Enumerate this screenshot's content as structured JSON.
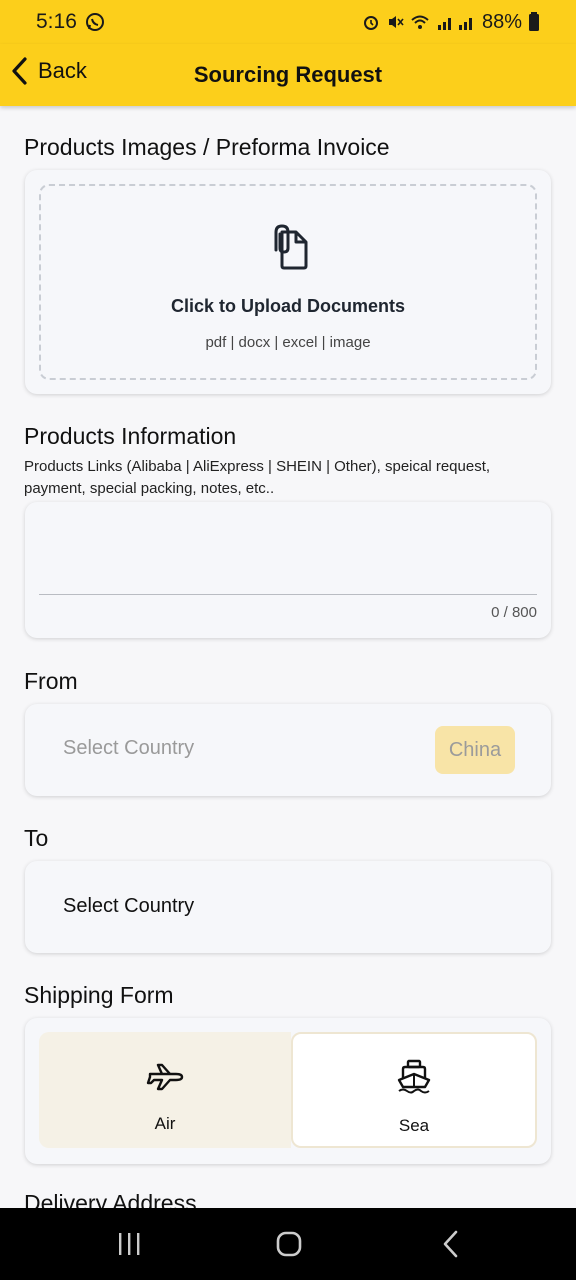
{
  "status": {
    "time": "5:16",
    "battery": "88%"
  },
  "header": {
    "back_label": "Back",
    "title": "Sourcing Request"
  },
  "upload_section": {
    "heading": "Products Images / Preforma Invoice",
    "cta": "Click to Upload Documents",
    "types": "pdf | docx | excel | image"
  },
  "info_section": {
    "heading": "Products Information",
    "helper": "Products Links (Alibaba | AliExpress | SHEIN | Other), speical request, payment, special packing, notes, etc..",
    "value": "",
    "counter": "0 / 800"
  },
  "from_section": {
    "heading": "From",
    "placeholder": "Select Country",
    "chip": "China"
  },
  "to_section": {
    "heading": "To",
    "placeholder": "Select Country"
  },
  "shipping": {
    "heading": "Shipping Form",
    "options": [
      {
        "label": "Air"
      },
      {
        "label": "Sea"
      }
    ]
  },
  "delivery": {
    "heading": "Delivery Address"
  },
  "colors": {
    "accent": "#fccf1b",
    "chip_bg": "#f8e4a7"
  },
  "icons": [
    "whatsapp-icon",
    "alarm-icon",
    "mute-icon",
    "wifi-icon",
    "signal-icon",
    "battery-icon",
    "chevron-left-icon",
    "document-clip-icon",
    "airplane-icon",
    "ship-icon",
    "recents-icon",
    "home-icon",
    "back-nav-icon"
  ]
}
